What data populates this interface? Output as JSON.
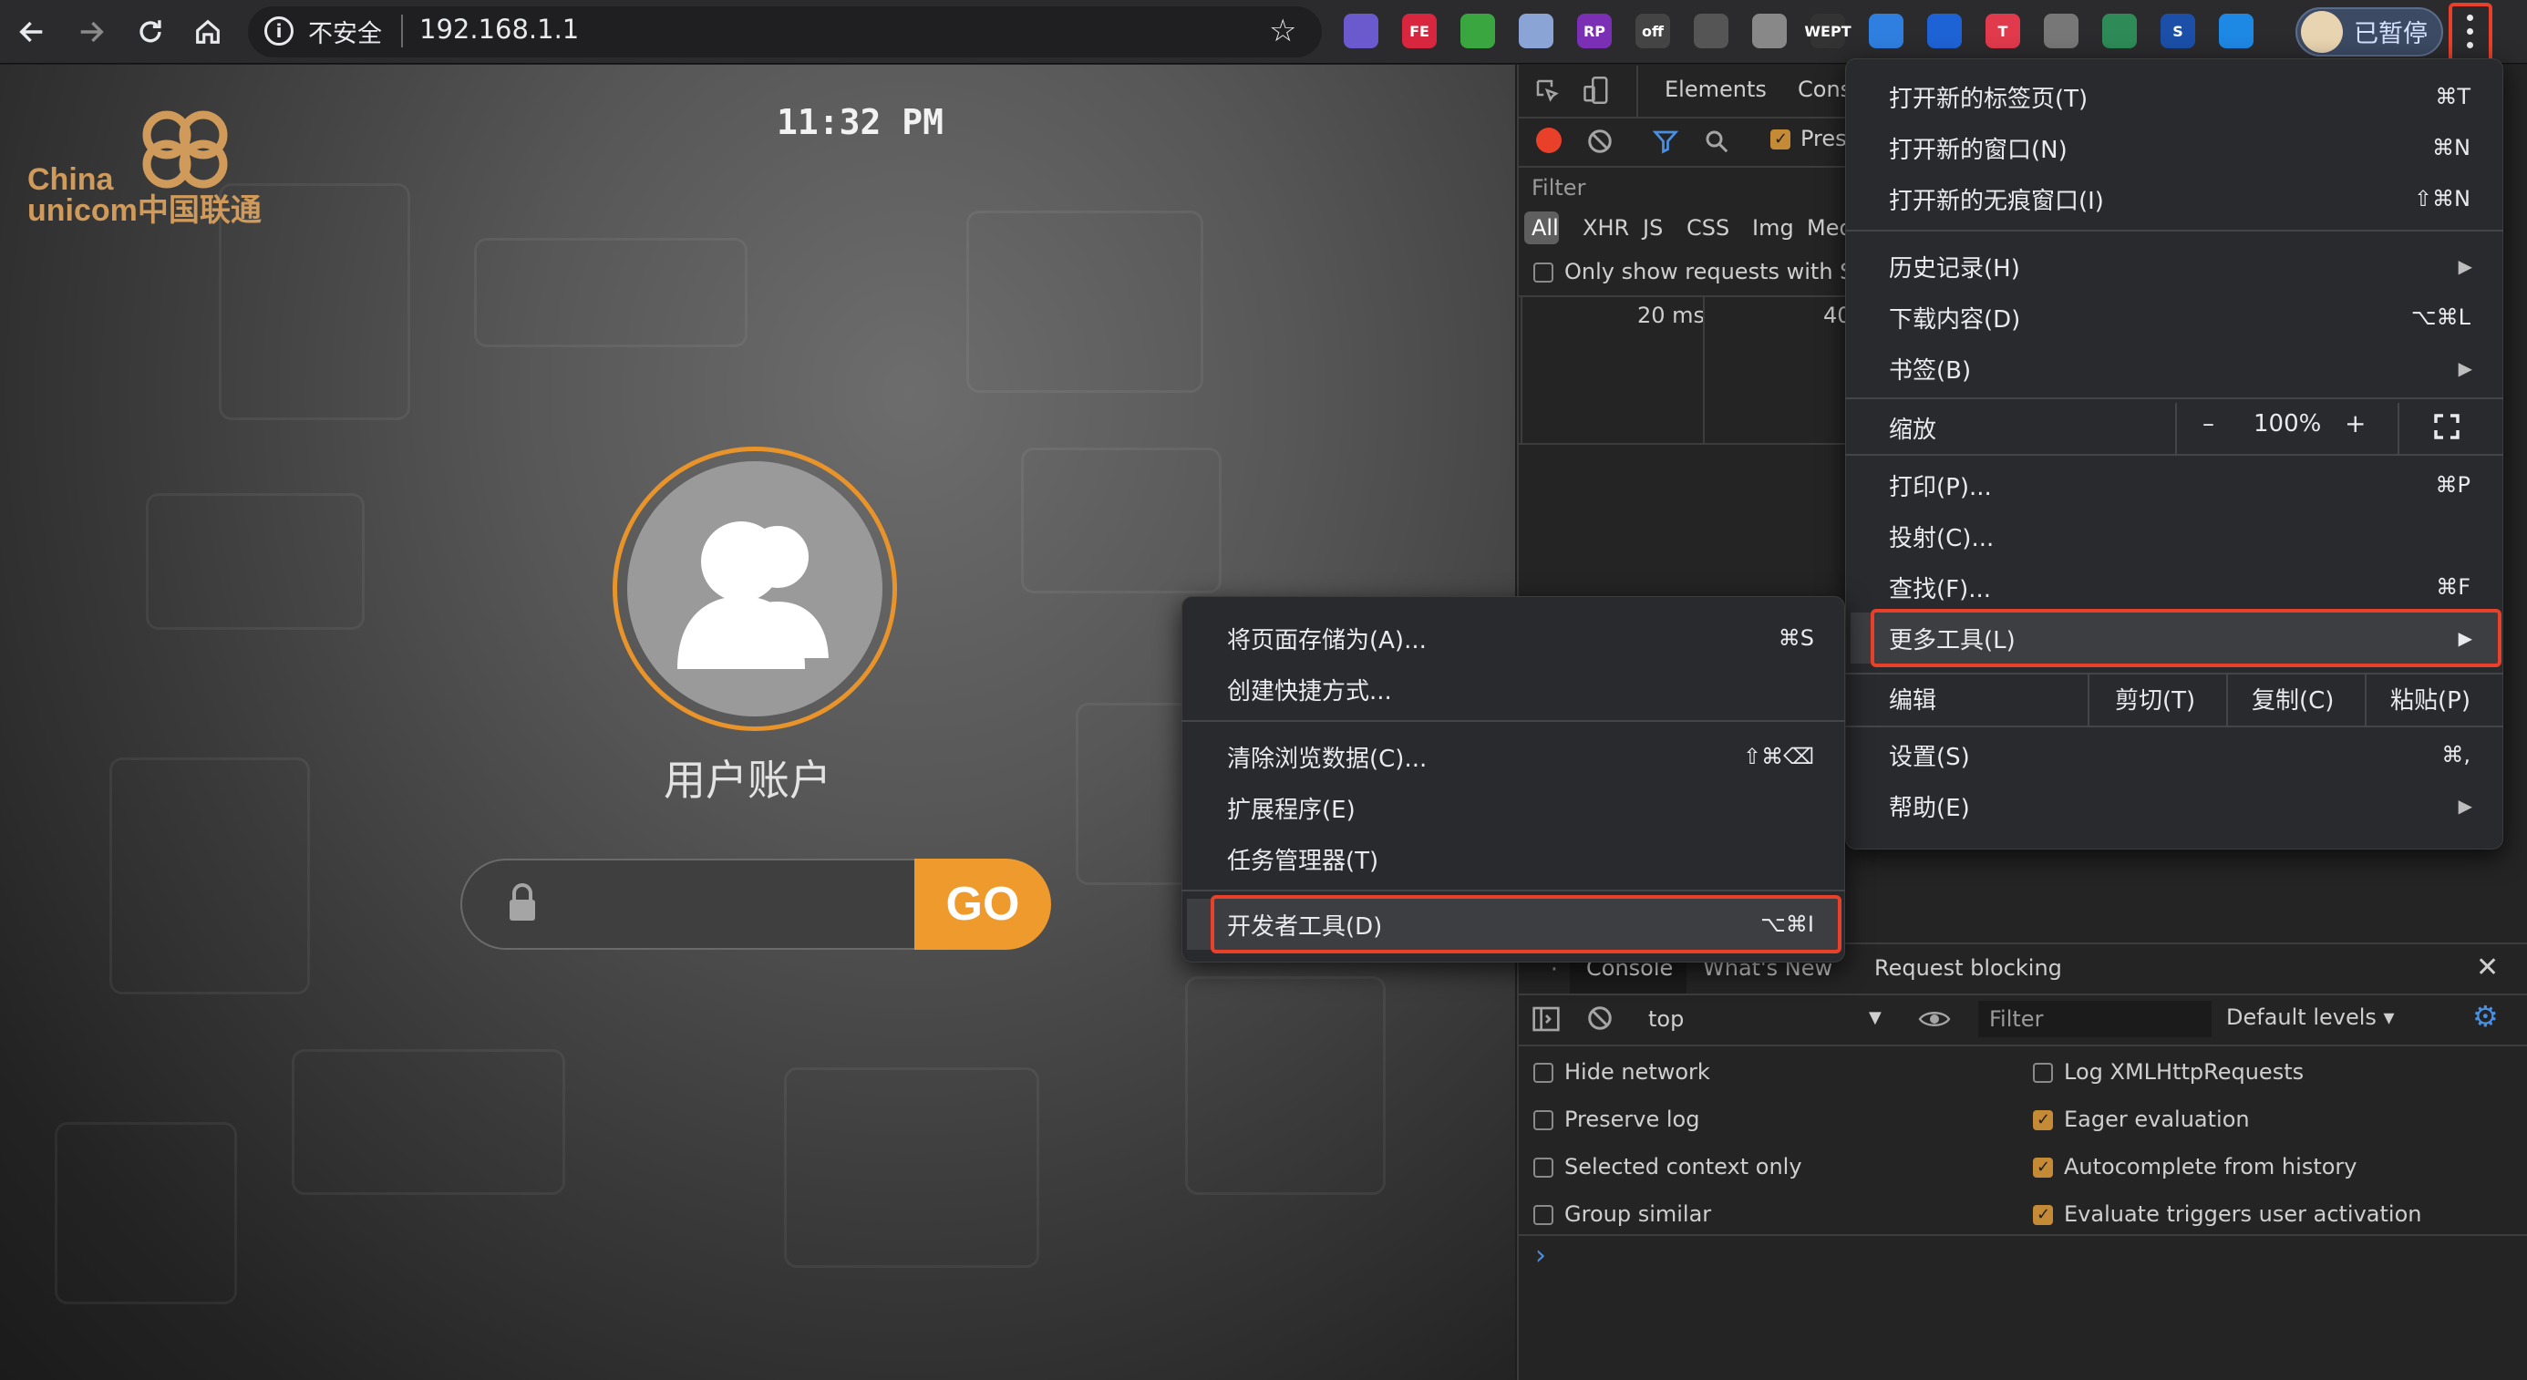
{
  "browser": {
    "omnibox": {
      "security_label": "不安全",
      "url": "192.168.1.1"
    },
    "profile_label": "已暂停",
    "extensions": [
      {
        "name": "ext-purple",
        "label": "",
        "color": "#6a5acd"
      },
      {
        "name": "ext-fe",
        "label": "FE",
        "color": "#d7263d"
      },
      {
        "name": "ext-leaf",
        "label": "",
        "color": "#3aa640"
      },
      {
        "name": "ext-disc",
        "label": "",
        "color": "#8aa4d6"
      },
      {
        "name": "ext-rp",
        "label": "RP",
        "color": "#7a2fb5"
      },
      {
        "name": "ext-off",
        "label": "off",
        "color": "#444444"
      },
      {
        "name": "ext-pocket",
        "label": "",
        "color": "#555555"
      },
      {
        "name": "ext-vue",
        "label": "",
        "color": "#888888"
      },
      {
        "name": "ext-wept",
        "label": "WEPT",
        "color": "#333333"
      },
      {
        "name": "ext-diamond",
        "label": "",
        "color": "#2f7fe0"
      },
      {
        "name": "ext-dropbox",
        "label": "",
        "color": "#1e63d6"
      },
      {
        "name": "ext-t",
        "label": "T",
        "color": "#e03a4c"
      },
      {
        "name": "ext-pen",
        "label": "",
        "color": "#777777"
      },
      {
        "name": "ext-bulb",
        "label": "",
        "color": "#2e8b57"
      },
      {
        "name": "ext-s",
        "label": "S",
        "color": "#1b4fa8"
      },
      {
        "name": "ext-screen",
        "label": "",
        "color": "#1e88e5"
      }
    ]
  },
  "page": {
    "logo_text_line1": "China",
    "logo_text_line2": "unicom中国联通",
    "clock": "11:32 PM",
    "user_label": "用户账户",
    "go_label": "GO"
  },
  "devtools": {
    "tabs": [
      "Elements",
      "Cons"
    ],
    "preserve_label": "Pres",
    "filter_placeholder": "Filter",
    "types": [
      "All",
      "XHR",
      "JS",
      "CSS",
      "Img",
      "Med"
    ],
    "same_site_label": "Only show requests with Sar",
    "timeline": [
      "20 ms",
      "40"
    ],
    "drawer_tabs": [
      "Console",
      "What's New",
      "Request blocking"
    ],
    "context": "top",
    "console_filter_placeholder": "Filter",
    "levels": "Default levels ▾",
    "options_left": [
      {
        "label": "Hide network",
        "checked": false
      },
      {
        "label": "Preserve log",
        "checked": false
      },
      {
        "label": "Selected context only",
        "checked": false
      },
      {
        "label": "Group similar",
        "checked": false
      }
    ],
    "options_right": [
      {
        "label": "Log XMLHttpRequests",
        "checked": false
      },
      {
        "label": "Eager evaluation",
        "checked": true
      },
      {
        "label": "Autocomplete from history",
        "checked": true
      },
      {
        "label": "Evaluate triggers user activation",
        "checked": true
      }
    ],
    "prompt": "›"
  },
  "main_menu": {
    "new_tab": {
      "label": "打开新的标签页(T)",
      "shortcut": "⌘T"
    },
    "new_window": {
      "label": "打开新的窗口(N)",
      "shortcut": "⌘N"
    },
    "incognito": {
      "label": "打开新的无痕窗口(I)",
      "shortcut": "⇧⌘N"
    },
    "history": {
      "label": "历史记录(H)"
    },
    "downloads": {
      "label": "下载内容(D)",
      "shortcut": "⌥⌘L"
    },
    "bookmarks": {
      "label": "书签(B)"
    },
    "zoom": {
      "label": "缩放",
      "minus": "–",
      "value": "100%",
      "plus": "+"
    },
    "print": {
      "label": "打印(P)...",
      "shortcut": "⌘P"
    },
    "cast": {
      "label": "投射(C)..."
    },
    "find": {
      "label": "查找(F)...",
      "shortcut": "⌘F"
    },
    "more_tools": {
      "label": "更多工具(L)"
    },
    "edit": {
      "label": "编辑",
      "cut": "剪切(T)",
      "copy": "复制(C)",
      "paste": "粘贴(P)"
    },
    "settings": {
      "label": "设置(S)",
      "shortcut": "⌘,"
    },
    "help": {
      "label": "帮助(E)"
    }
  },
  "sub_menu": {
    "save_page": {
      "label": "将页面存储为(A)...",
      "shortcut": "⌘S"
    },
    "create_shortcut": {
      "label": "创建快捷方式..."
    },
    "clear_data": {
      "label": "清除浏览数据(C)...",
      "shortcut": "⇧⌘⌫"
    },
    "extensions": {
      "label": "扩展程序(E)"
    },
    "task_manager": {
      "label": "任务管理器(T)"
    },
    "dev_tools": {
      "label": "开发者工具(D)",
      "shortcut": "⌥⌘I"
    }
  },
  "colors": {
    "accent": "#ef9a2d",
    "highlight": "#e9402a",
    "menu_bg": "#292a2d"
  }
}
